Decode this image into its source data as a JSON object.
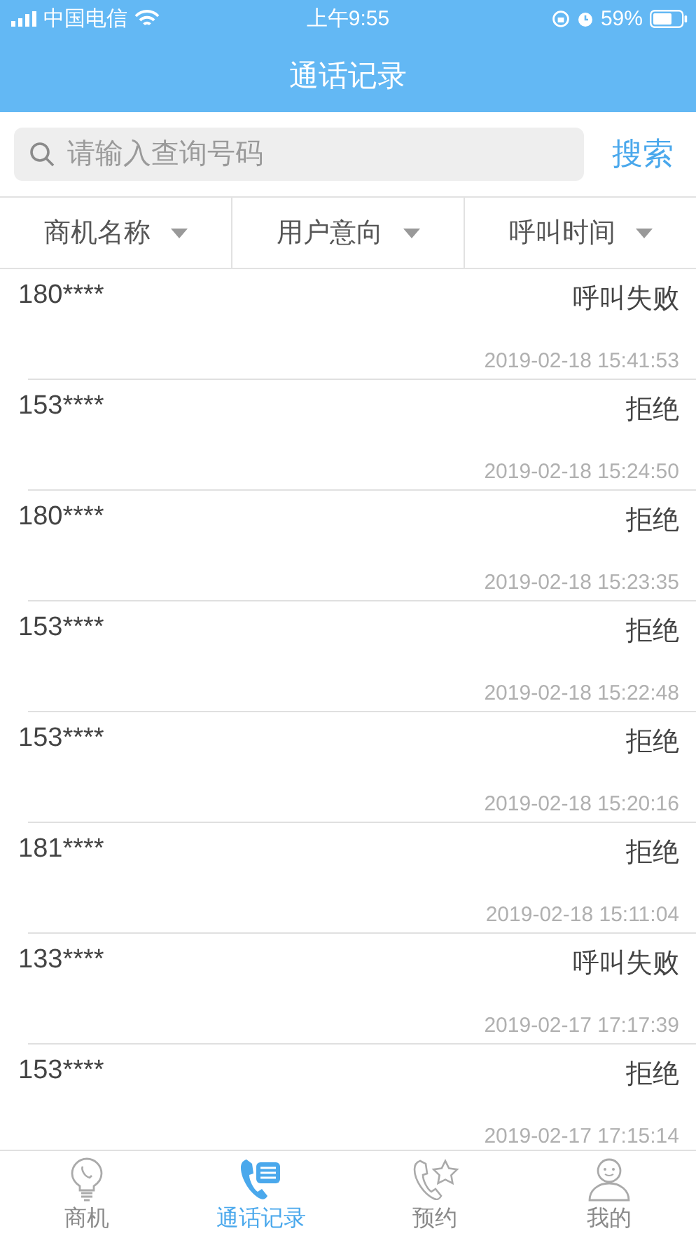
{
  "status_bar": {
    "carrier": "中国电信",
    "time": "上午9:55",
    "battery": "59%"
  },
  "title": "通话记录",
  "search": {
    "placeholder": "请输入查询号码",
    "button": "搜索"
  },
  "filters": [
    {
      "label": "商机名称"
    },
    {
      "label": "用户意向"
    },
    {
      "label": "呼叫时间"
    }
  ],
  "records": [
    {
      "number": "180****",
      "status": "呼叫失败",
      "time": "2019-02-18 15:41:53"
    },
    {
      "number": "153****",
      "status": "拒绝",
      "time": "2019-02-18 15:24:50"
    },
    {
      "number": "180****",
      "status": "拒绝",
      "time": "2019-02-18 15:23:35"
    },
    {
      "number": "153****",
      "status": "拒绝",
      "time": "2019-02-18 15:22:48"
    },
    {
      "number": "153****",
      "status": "拒绝",
      "time": "2019-02-18 15:20:16"
    },
    {
      "number": "181****",
      "status": "拒绝",
      "time": "2019-02-18 15:11:04"
    },
    {
      "number": "133****",
      "status": "呼叫失败",
      "time": "2019-02-17 17:17:39"
    },
    {
      "number": "153****",
      "status": "拒绝",
      "time": "2019-02-17 17:15:14"
    }
  ],
  "tabs": [
    {
      "label": "商机",
      "selected": false
    },
    {
      "label": "通话记录",
      "selected": true
    },
    {
      "label": "预约",
      "selected": false
    },
    {
      "label": "我的",
      "selected": false
    }
  ]
}
